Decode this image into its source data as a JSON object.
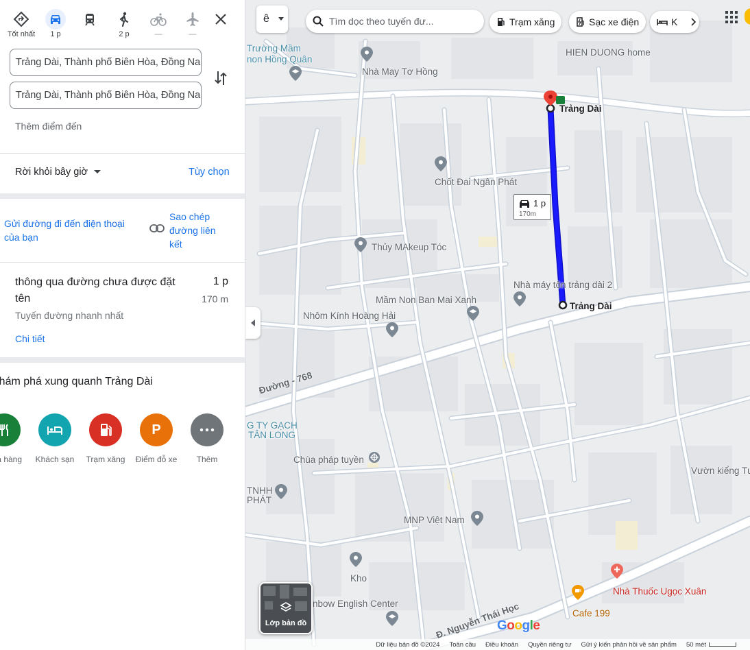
{
  "panel": {
    "modes": [
      {
        "label": "Tốt nhất",
        "icon": "directions-diamond-icon"
      },
      {
        "label": "1 p",
        "icon": "car-icon",
        "active": true
      },
      {
        "label": "",
        "icon": "train-icon"
      },
      {
        "label": "2 p",
        "icon": "walk-icon"
      },
      {
        "label": "—",
        "icon": "bike-icon"
      },
      {
        "label": "—",
        "icon": "plane-icon"
      }
    ],
    "origin": "Trảng Dài, Thành phố Biên Hòa, Đồng Nai",
    "destination": "Trảng Dài, Thành phố Biên Hòa, Đồng Nai",
    "add_destination": "Thêm điểm đến",
    "depart_label": "Rời khỏi bây giờ",
    "options_label": "Tùy chọn",
    "send_label": "Gửi đường đi đến điện thoại của bạn",
    "copy_label": "Sao chép đường liên kết",
    "route": {
      "title": "thông qua đường chưa được đặt tên",
      "time": "1 p",
      "distance": "170 m",
      "subtitle": "Tuyến đường nhanh nhất",
      "details": "Chi tiết"
    },
    "explore_title": "Khám phá xung quanh Trảng Dài",
    "categories": [
      {
        "label": "Nhà hàng",
        "color": "#188038"
      },
      {
        "label": "Khách sạn",
        "color": "#12a4af"
      },
      {
        "label": "Trạm xăng",
        "color": "#d93025"
      },
      {
        "label": "Điểm đỗ xe",
        "color": "#e8710a"
      },
      {
        "label": "Thêm",
        "color": "#70757a"
      }
    ]
  },
  "map": {
    "lang_button": "ê",
    "search_placeholder": "Tìm dọc theo tuyến đư...",
    "chips": [
      "Trạm xăng",
      "Sạc xe điện",
      "K"
    ],
    "route_chip": {
      "time": "1 p",
      "distance": "170m"
    },
    "labels": {
      "school1a": "Trường Mầm",
      "school1b": "non Hồng Quân",
      "hien_duong": "HIEN DUONG home",
      "nha_may": "Nhà May Tơ Hồng",
      "trang_dai_top": "Trảng Dài",
      "chot_dai": "Chốt Đai Ngân Phát",
      "thuy_makeup": "Thủy MAkeup Tóc",
      "nha_may_ton": "Nhà máy tôn trảng dài 2",
      "trang_dai_bottom": "Trảng Dài",
      "mam_non": "Mầm Non Ban Mai Xanh",
      "nhom_kinh": "Nhôm Kính Hoàng Hải",
      "duong_768": "Đường - 768",
      "cty_gach_a": "G TY GẠCH",
      "cty_gach_b": "TÂN LONG",
      "chua": "Chùa pháp tuyền",
      "vuon_kieng": "Vườn kiểng Tư",
      "tnhh_a": "TNHH",
      "tnhh_b": "PHÁT",
      "mnp": "MNP Việt Nam",
      "kho": "Kho",
      "rainbow": "nbow English Center",
      "nguyen_thai_hoc": "Đ. Nguyễn Thái Học",
      "nha_thuoc": "Nhà Thuốc Ugọc Xuân",
      "cafe": "Cafe 199"
    },
    "layers_label": "Lớp bản đồ",
    "google": "Google",
    "footer": [
      "Dữ liệu bản đồ ©2024",
      "Toàn cầu",
      "Điều khoản",
      "Quyền riêng tư",
      "Gửi ý kiến phản hồi về sản phẩm",
      "50 mét"
    ]
  },
  "colors": {
    "route": "#1a1aff",
    "link": "#1a73e8",
    "pin": "#ea4335"
  }
}
